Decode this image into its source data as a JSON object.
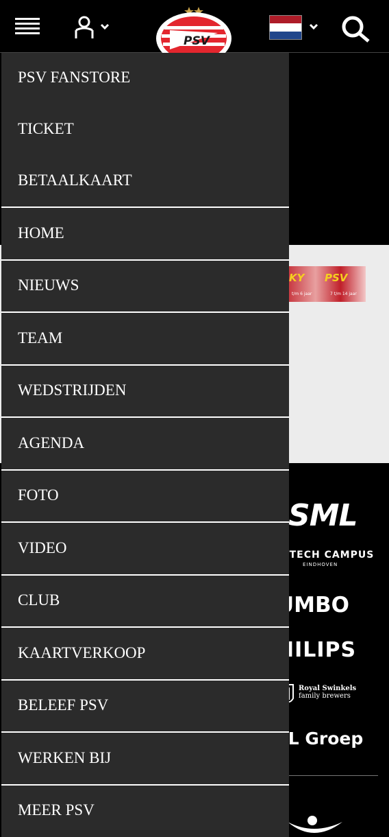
{
  "header": {
    "menu_icon": "hamburger-menu-icon",
    "user_icon": "user-icon",
    "language_flag": "netherlands-flag",
    "search_icon": "search-icon",
    "logo_text": "PSV",
    "flag_colors": [
      "#ae1c28",
      "#ffffff",
      "#21468b"
    ]
  },
  "top_links": [
    {
      "label": "PSV FANSTORE"
    },
    {
      "label": "TICKET"
    },
    {
      "label": "BETAALKAART"
    }
  ],
  "menu": [
    {
      "label": "HOME"
    },
    {
      "label": "NIEUWS"
    },
    {
      "label": "TEAM"
    },
    {
      "label": "WEDSTRIJDEN"
    },
    {
      "label": "AGENDA"
    },
    {
      "label": "FOTO"
    },
    {
      "label": "VIDEO"
    },
    {
      "label": "CLUB"
    },
    {
      "label": "KAARTVERKOOP"
    },
    {
      "label": "BELEEF PSV"
    },
    {
      "label": "WERKEN BIJ"
    },
    {
      "label": "MEER PSV"
    }
  ],
  "background": {
    "banner": {
      "left_text": "KY",
      "right_text": "PSV",
      "left_sub": "t/m 6 jaar",
      "right_sub": "7 t/m 14 jaar"
    },
    "sponsors": {
      "asml": "ASML",
      "campus": "H TECH CAMPUS",
      "campus_sub": "EINDHOVEN",
      "jumbo": "UMBO",
      "philips": "HILIPS",
      "swinkels_line1": "Royal Swinkels",
      "swinkels_line2": "family brewers",
      "vdl": "DL Groep"
    }
  },
  "colors": {
    "header_bg": "#000000",
    "drawer_bg": "#2b2b2b",
    "separator": "#ffffff",
    "gray_section": "#ececec"
  }
}
